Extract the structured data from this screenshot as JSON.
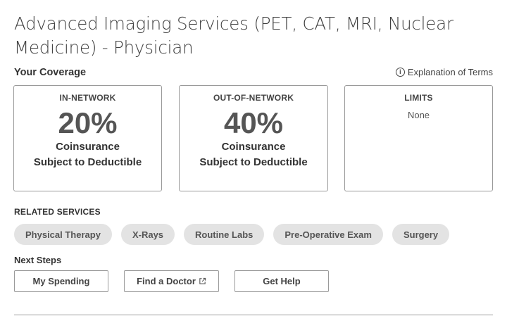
{
  "page": {
    "title": "Advanced Imaging Services (PET, CAT, MRI, Nuclear Medicine) - Physician"
  },
  "coverage": {
    "label": "Your Coverage",
    "explanation_link": "Explanation of Terms",
    "explanation_icon": "info-icon",
    "in_network": {
      "heading": "IN-NETWORK",
      "percent": "20%",
      "line1": "Coinsurance",
      "line2": "Subject to Deductible"
    },
    "out_of_network": {
      "heading": "OUT-OF-NETWORK",
      "percent": "40%",
      "line1": "Coinsurance",
      "line2": "Subject to Deductible"
    },
    "limits": {
      "heading": "LIMITS",
      "value": "None"
    }
  },
  "related": {
    "label": "RELATED SERVICES",
    "chips": [
      "Physical Therapy",
      "X-Rays",
      "Routine Labs",
      "Pre-Operative Exam",
      "Surgery"
    ]
  },
  "next_steps": {
    "label": "Next Steps",
    "buttons": [
      "My Spending",
      "Find a Doctor",
      "Get Help"
    ],
    "find_doctor_icon": "external-link-icon"
  }
}
